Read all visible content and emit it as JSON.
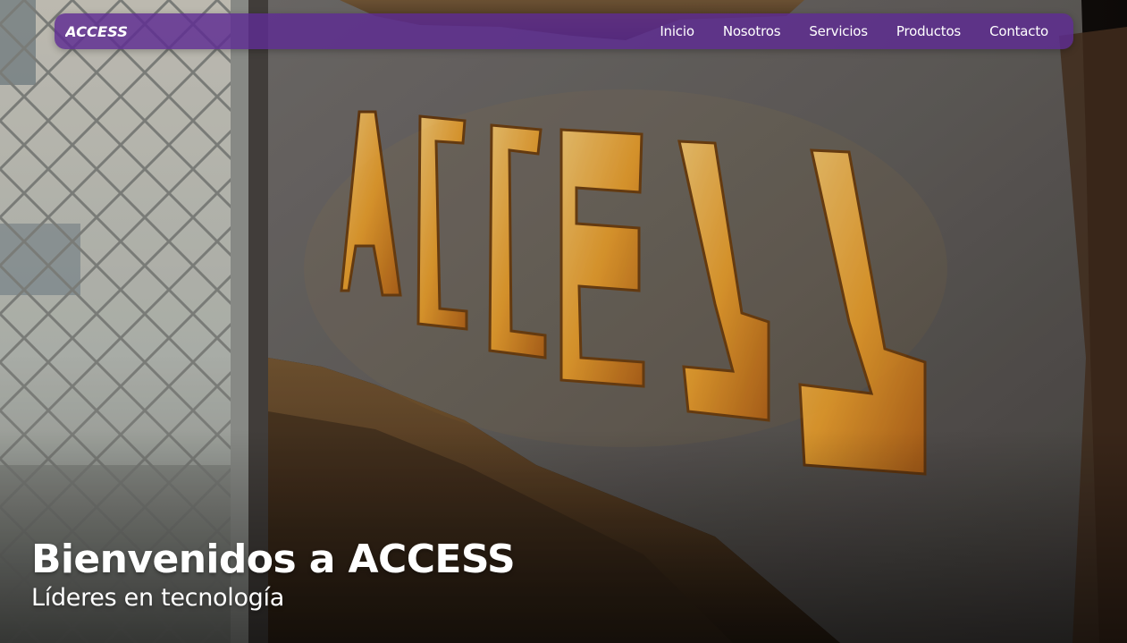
{
  "brand": {
    "logo_text": "ACCESS",
    "logo_color": "#ffffff"
  },
  "navbar": {
    "background": "#5e2c92",
    "links": [
      {
        "label": "Inicio"
      },
      {
        "label": "Nosotros"
      },
      {
        "label": "Servicios"
      },
      {
        "label": "Productos"
      },
      {
        "label": "Contacto"
      }
    ]
  },
  "hero": {
    "title": "Bienvenidos a ACCESS",
    "subtitle": "Líderes en tecnología",
    "sign_text": "ACCESS",
    "glow_color": "#f2a531"
  }
}
